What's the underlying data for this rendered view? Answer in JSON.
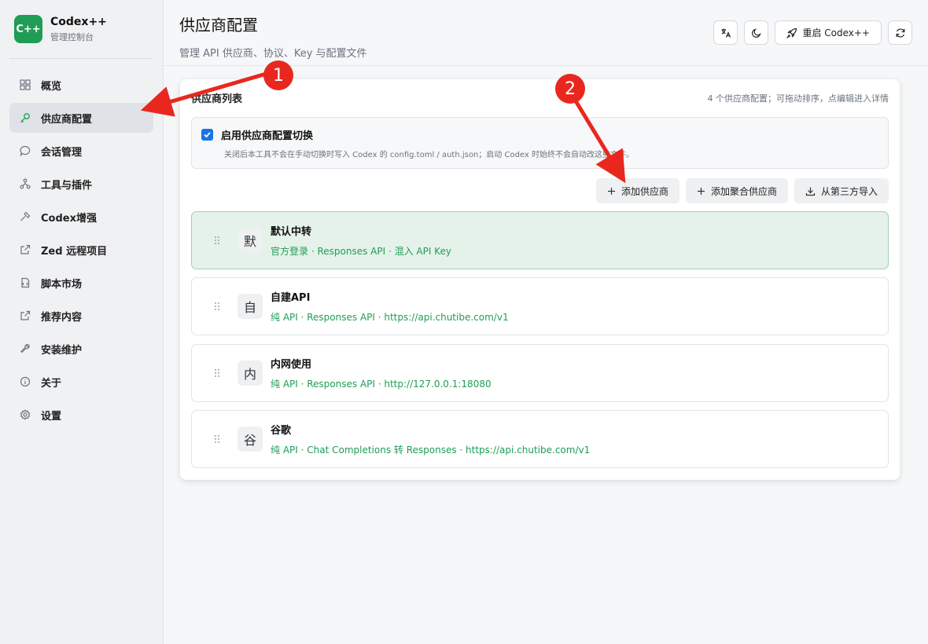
{
  "brand": {
    "logo": "C++",
    "title": "Codex++",
    "subtitle": "管理控制台"
  },
  "sidebar": {
    "items": [
      {
        "label": "概览",
        "icon": "grid-icon",
        "active": false
      },
      {
        "label": "供应商配置",
        "icon": "key-icon",
        "active": true
      },
      {
        "label": "会话管理",
        "icon": "chat-icon",
        "active": false
      },
      {
        "label": "工具与插件",
        "icon": "plugin-icon",
        "active": false
      },
      {
        "label": "Codex增强",
        "icon": "hammer-icon",
        "active": false
      },
      {
        "label": "Zed 远程项目",
        "icon": "external-link-icon",
        "active": false
      },
      {
        "label": "脚本市场",
        "icon": "script-icon",
        "active": false
      },
      {
        "label": "推荐内容",
        "icon": "external-link-icon",
        "active": false
      },
      {
        "label": "安装维护",
        "icon": "wrench-icon",
        "active": false
      },
      {
        "label": "关于",
        "icon": "info-icon",
        "active": false
      },
      {
        "label": "设置",
        "icon": "gear-icon",
        "active": false
      }
    ]
  },
  "header": {
    "title": "供应商配置",
    "subtitle": "管理 API 供应商、协议、Key 与配置文件",
    "restart_label": "重启 Codex++"
  },
  "card": {
    "title": "供应商列表",
    "meta": "4 个供应商配置；可拖动排序，点编辑进入详情",
    "toggle": {
      "label": "启用供应商配置切换",
      "description": "关闭后本工具不会在手动切换时写入 Codex 的 config.toml / auth.json；启动 Codex 时始终不会自动改这些文件。",
      "checked": true
    },
    "actions": {
      "add": "添加供应商",
      "add_aggregate": "添加聚合供应商",
      "import": "从第三方导入"
    },
    "providers": [
      {
        "avatar": "默",
        "name": "默认中转",
        "desc": "官方登录 · Responses API · 混入 API Key",
        "active": true
      },
      {
        "avatar": "自",
        "name": "自建API",
        "desc": "纯 API · Responses API · https://api.chutibe.com/v1",
        "active": false
      },
      {
        "avatar": "内",
        "name": "内网使用",
        "desc": "纯 API · Responses API · http://127.0.0.1:18080",
        "active": false
      },
      {
        "avatar": "谷",
        "name": "谷歌",
        "desc": "纯 API · Chat Completions 转 Responses · https://api.chutibe.com/v1",
        "active": false
      }
    ]
  },
  "annotations": {
    "marker1": "1",
    "marker2": "2"
  },
  "colors": {
    "accent": "#1f9d55",
    "marker": "#e8281e",
    "checkbox": "#1a73e8"
  }
}
